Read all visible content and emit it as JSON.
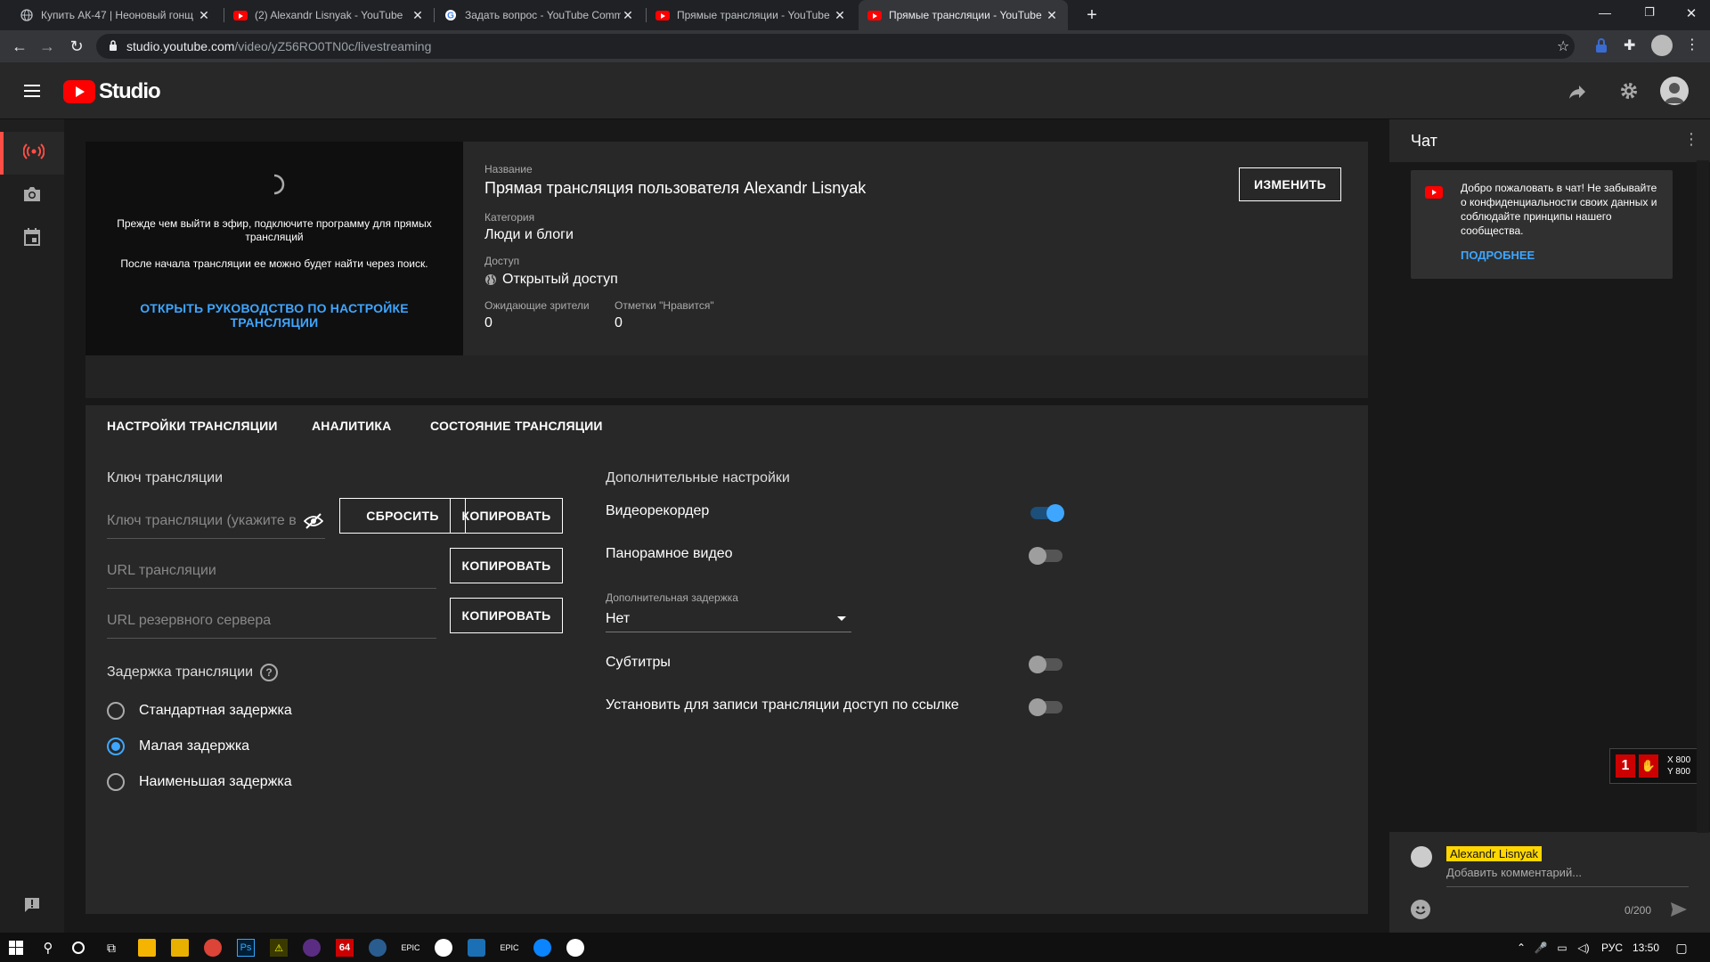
{
  "browser": {
    "tabs": [
      {
        "label": "Купить АК-47 | Неоновый гонщ",
        "icon": "globe-icon"
      },
      {
        "label": "(2) Alexandr Lisnyak - YouTube",
        "icon": "youtube-icon"
      },
      {
        "label": "Задать вопрос - YouTube Comm",
        "icon": "google-icon"
      },
      {
        "label": "Прямые трансляции - YouTube",
        "icon": "youtube-icon"
      },
      {
        "label": "Прямые трансляции - YouTube",
        "icon": "youtube-icon"
      }
    ],
    "new_tab": "+",
    "url_host": "studio.youtube.com",
    "url_path": "/video/yZ56RO0TN0c/livestreaming"
  },
  "header": {
    "logo_text": "Studio"
  },
  "preview": {
    "line1": "Прежде чем выйти в эфир, подключите программу для прямых трансляций",
    "line2": "После начала трансляции ее можно будет найти через поиск.",
    "guide_link": "ОТКРЫТЬ РУКОВОДСТВО ПО НАСТРОЙКЕ ТРАНСЛЯЦИИ"
  },
  "info": {
    "title_label": "Название",
    "title_value": "Прямая трансляция пользователя Alexandr Lisnyak",
    "category_label": "Категория",
    "category_value": "Люди и блоги",
    "access_label": "Доступ",
    "access_value": "Открытый доступ",
    "viewers_label": "Ожидающие зрители",
    "viewers_value": "0",
    "likes_label": "Отметки \"Нравится\"",
    "likes_value": "0",
    "edit_button": "ИЗМЕНИТЬ"
  },
  "tabs": [
    {
      "label": "НАСТРОЙКИ ТРАНСЛЯЦИИ"
    },
    {
      "label": "АНАЛИТИКА"
    },
    {
      "label": "СОСТОЯНИЕ ТРАНСЛЯЦИИ"
    }
  ],
  "stream": {
    "key_heading": "Ключ трансляции",
    "key_placeholder": "Ключ трансляции (укажите в",
    "reset_button": "СБРОСИТЬ",
    "copy_button": "КОПИРОВАТЬ",
    "url_placeholder": "URL трансляции",
    "backup_url_placeholder": "URL резервного сервера",
    "latency_heading": "Задержка трансляции",
    "latency_options": [
      {
        "label": "Стандартная задержка",
        "checked": false
      },
      {
        "label": "Малая задержка",
        "checked": true
      },
      {
        "label": "Наименьшая задержка",
        "checked": false
      }
    ]
  },
  "additional": {
    "heading": "Дополнительные настройки",
    "dvr_label": "Видеорекордер",
    "dvr_on": true,
    "panorama_label": "Панорамное видео",
    "panorama_on": false,
    "delay_label": "Дополнительная задержка",
    "delay_value": "Нет",
    "subtitles_label": "Субтитры",
    "subtitles_on": false,
    "unlisted_label": "Установить для записи трансляции доступ по ссылке",
    "unlisted_on": false
  },
  "chat": {
    "title": "Чат",
    "welcome": "Добро пожаловать в чат! Не забывайте о конфиденциальности своих данных и соблюдайте принципы нашего сообщества.",
    "more_link": "ПОДРОБНЕЕ",
    "user_name": "Alexandr Lisnyak",
    "comment_placeholder": "Добавить комментарий...",
    "char_count": "0/200"
  },
  "overlay": {
    "x": "X 800",
    "y": "Y 800"
  },
  "taskbar": {
    "lang": "РУС",
    "time": "13:50"
  },
  "colors": {
    "accent_blue": "#3ea6ff",
    "youtube_red": "#ff0000",
    "chat_name_bg": "#ffd600"
  }
}
